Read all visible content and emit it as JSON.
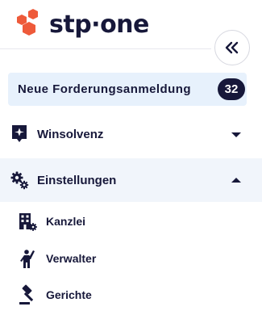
{
  "brand": {
    "logo_text": "stp·one",
    "logo_color": "#ee5a3a",
    "text_color": "#17183a"
  },
  "collapse_button": {
    "icon": "double-chevron-left-icon"
  },
  "new_claim": {
    "label": "Neue Forderungsanmeldung",
    "count": "32",
    "background": "#e7f1fc"
  },
  "nav": {
    "sections": [
      {
        "label": "Winsolvenz",
        "icon": "winsolvenz-shield-icon",
        "expanded": false
      },
      {
        "label": "Einstellungen",
        "icon": "settings-gears-icon",
        "expanded": true
      }
    ],
    "settings_items": [
      {
        "label": "Kanzlei",
        "icon": "office-building-icon"
      },
      {
        "label": "Verwalter",
        "icon": "administrator-person-icon"
      },
      {
        "label": "Gerichte",
        "icon": "gavel-icon"
      }
    ]
  }
}
